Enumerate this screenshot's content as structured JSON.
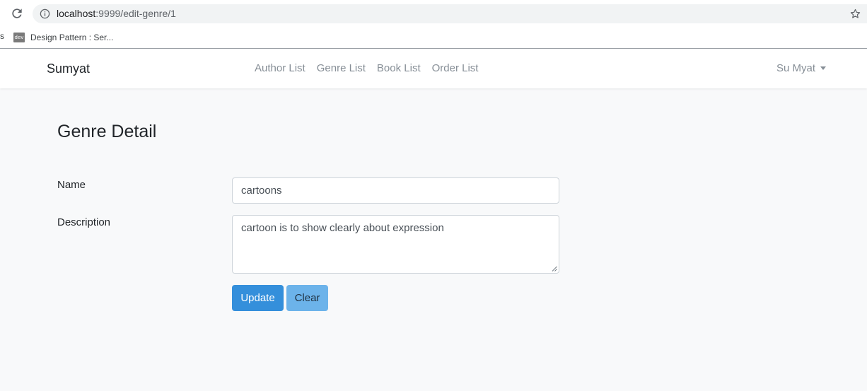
{
  "browser": {
    "url_host": "localhost",
    "url_path": ":9999/edit-genre/1",
    "bookmark_fragment": "s",
    "bookmark_icon_text": "dev",
    "bookmark_label": "Design Pattern : Ser..."
  },
  "navbar": {
    "brand": "Sumyat",
    "links": [
      "Author List",
      "Genre List",
      "Book List",
      "Order List"
    ],
    "user": "Su Myat"
  },
  "form": {
    "title": "Genre Detail",
    "name_label": "Name",
    "name_value": "cartoons",
    "description_label": "Description",
    "description_value": "cartoon is to show clearly about expression",
    "update_label": "Update",
    "clear_label": "Clear"
  },
  "colors": {
    "primary": "#348fdb",
    "primary_light": "#6cb3ea",
    "page_background": "#f8f9fa"
  }
}
